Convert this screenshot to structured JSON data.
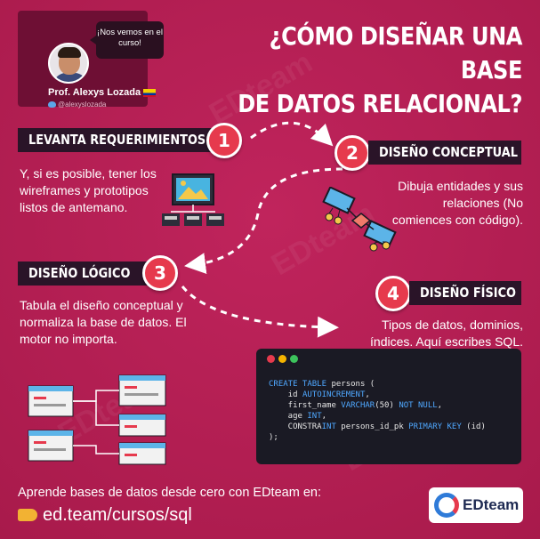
{
  "author": {
    "bubble": "¡Nos vemos en el curso!",
    "name": "Prof. Alexys Lozada",
    "handle": "@alexyslozada"
  },
  "title": {
    "line1": "¿CÓMO DISEÑAR UNA BASE",
    "line2": "DE DATOS RELACIONAL?"
  },
  "steps": [
    {
      "number": "1",
      "label": "LEVANTA REQUERIMIENTOS",
      "description": "Y, si es posible, tener los wireframes y prototipos listos de antemano."
    },
    {
      "number": "2",
      "label": "DISEÑO CONCEPTUAL",
      "description": "Dibuja entidades y sus relaciones (No comiences con código)."
    },
    {
      "number": "3",
      "label": "DISEÑO LÓGICO",
      "description": "Tabula el diseño conceptual y normaliza la base de datos. El motor no importa."
    },
    {
      "number": "4",
      "label": "DISEÑO FÍSICO",
      "description": "Tipos de datos, dominios, índices. Aquí escribes SQL."
    }
  ],
  "code": {
    "lines": [
      "CREATE TABLE persons (",
      "    id AUTOINCREMENT,",
      "    first_name VARCHAR(50) NOT NULL,",
      "    age INT,",
      "    CONSTRAINT persons_id_pk PRIMARY KEY (id)",
      ");"
    ]
  },
  "footer": {
    "text": "Aprende bases de datos desde cero con EDteam en:",
    "link": "ed.team/cursos/sql",
    "brand": "EDteam"
  },
  "watermark": "EDteam",
  "colors": {
    "background": "#b41d52",
    "label_bg": "#2a1428",
    "accent_red": "#e63a4d",
    "code_keyword": "#4fa8ff"
  }
}
